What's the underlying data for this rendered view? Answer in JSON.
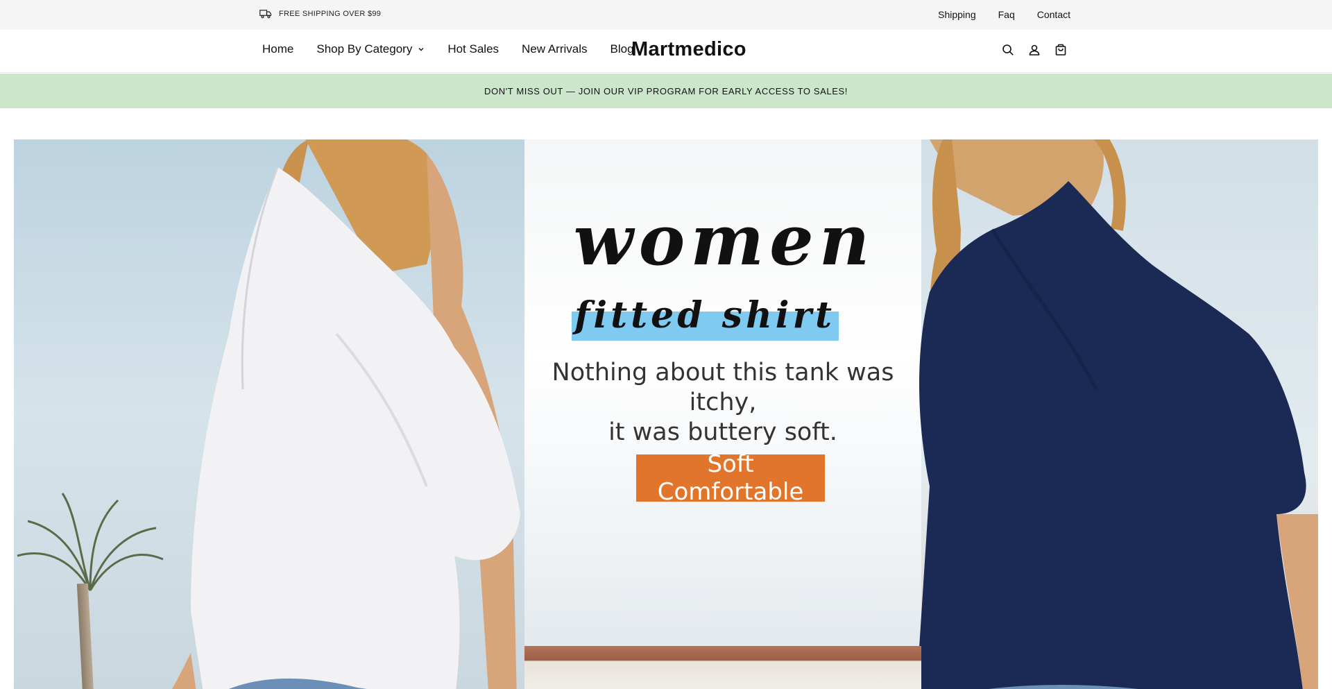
{
  "topbar": {
    "shipping_note": "FREE SHIPPING OVER $99",
    "links": [
      "Shipping",
      "Faq",
      "Contact"
    ]
  },
  "header": {
    "nav": [
      "Home",
      "Shop By Category",
      "Hot Sales",
      "New Arrivals",
      "Blog"
    ],
    "logo": "Martmedico",
    "icons": [
      "search-icon",
      "account-icon",
      "cart-icon"
    ]
  },
  "promo": {
    "text": "DON'T MISS OUT — JOIN OUR VIP PROGRAM FOR EARLY ACCESS TO SALES!",
    "background": "#cce6cc"
  },
  "hero": {
    "title": "women",
    "subtitle": "fitted shirt",
    "tagline_line1": "Nothing about this tank was itchy,",
    "tagline_line2": "it was buttery soft.",
    "cta": "Soft Comfortable",
    "cta_color": "#e2752c",
    "subtitle_bar_color": "#7fcaf0",
    "left_shirt_color": "#f2f2f4",
    "right_shirt_color": "#1b2a55"
  }
}
